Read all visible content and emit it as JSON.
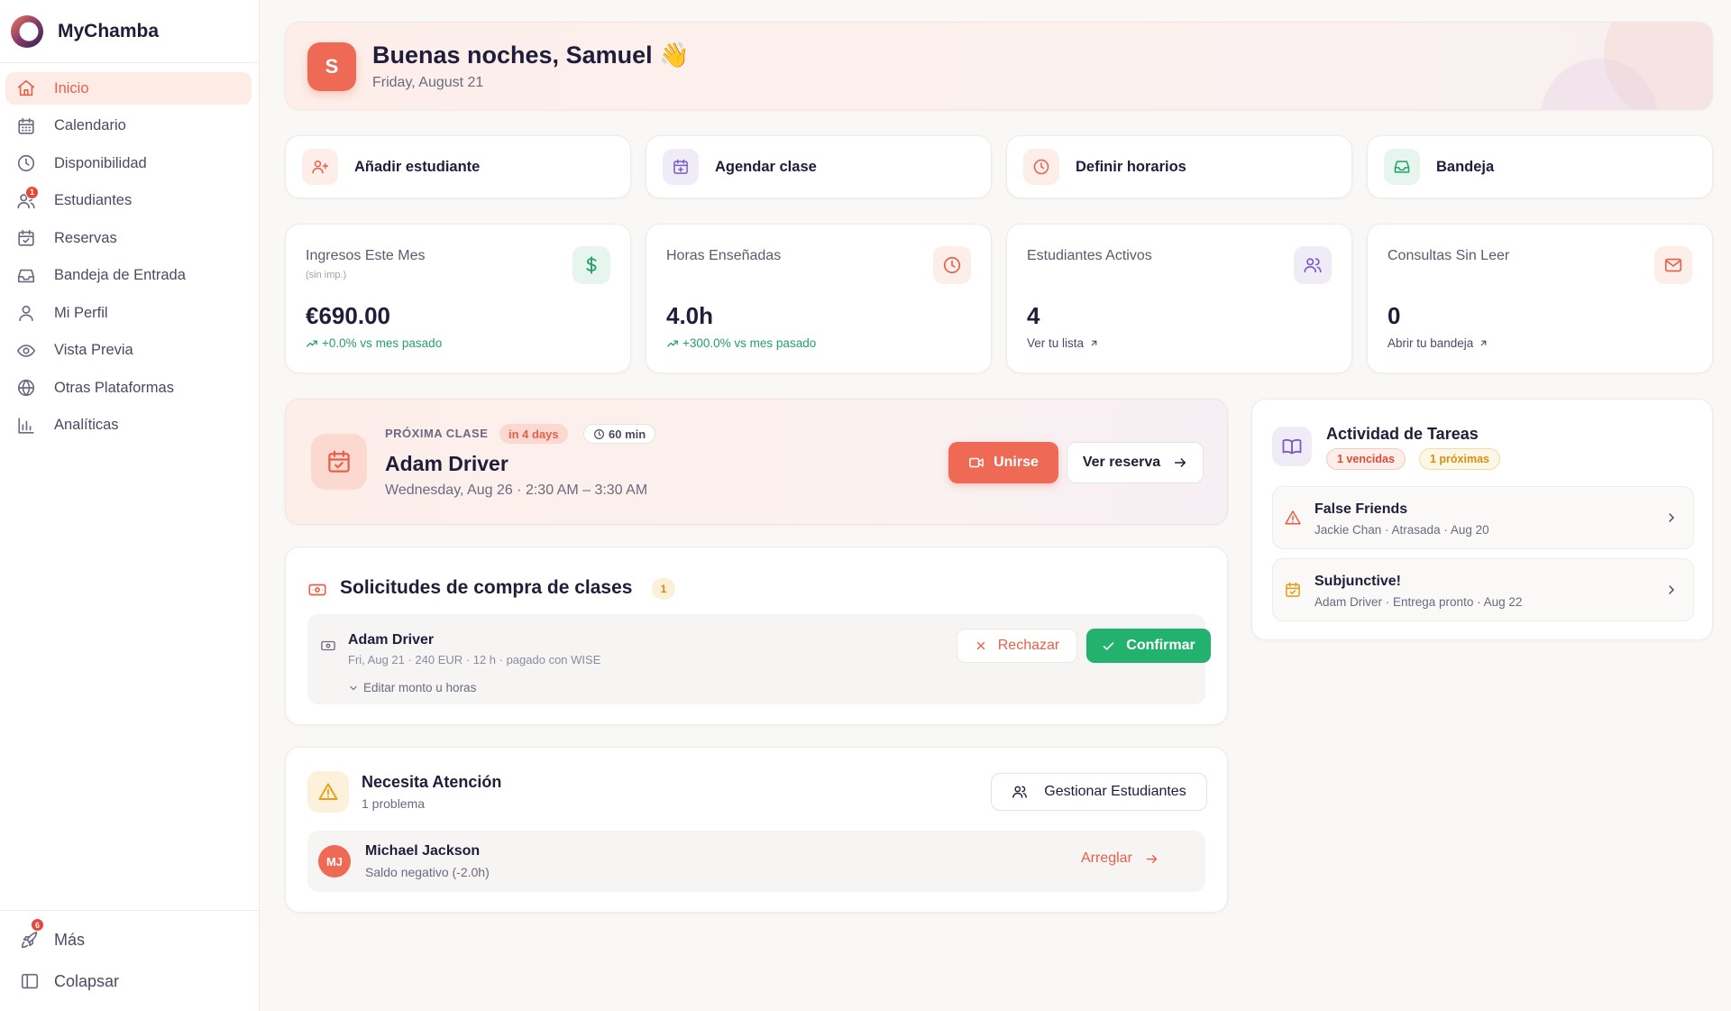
{
  "brand": {
    "name": "MyChamba"
  },
  "sidebar": {
    "items": [
      {
        "label": "Inicio",
        "icon": "home-icon",
        "active": true
      },
      {
        "label": "Calendario",
        "icon": "calendar-icon"
      },
      {
        "label": "Disponibilidad",
        "icon": "clock-icon"
      },
      {
        "label": "Estudiantes",
        "icon": "users-icon",
        "badge": "1"
      },
      {
        "label": "Reservas",
        "icon": "calendar-check-icon"
      },
      {
        "label": "Bandeja de Entrada",
        "icon": "inbox-icon"
      },
      {
        "label": "Mi Perfil",
        "icon": "user-icon"
      },
      {
        "label": "Vista Previa",
        "icon": "eye-icon"
      },
      {
        "label": "Otras Plataformas",
        "icon": "globe-icon"
      },
      {
        "label": "Analíticas",
        "icon": "bar-chart-icon"
      }
    ],
    "footer": {
      "more_label": "Más",
      "more_badge": "6",
      "collapse_label": "Colapsar"
    }
  },
  "greeting": {
    "avatar_initial": "S",
    "title": "Buenas noches, Samuel 👋",
    "date": "Friday, August 21"
  },
  "quick_actions": [
    {
      "label": "Añadir estudiante",
      "icon": "user-plus-icon",
      "color": "#e8604c",
      "bg": "#fdeeea"
    },
    {
      "label": "Agendar clase",
      "icon": "calendar-plus-icon",
      "color": "#7c5cc4",
      "bg": "#f0ecf7"
    },
    {
      "label": "Definir horarios",
      "icon": "clock-icon",
      "color": "#e8604c",
      "bg": "#fdeeea"
    },
    {
      "label": "Bandeja",
      "icon": "inbox-icon",
      "color": "#22a06b",
      "bg": "#e6f6ee"
    }
  ],
  "stats": [
    {
      "title": "Ingresos Este Mes",
      "sub": "(sin imp.)",
      "value": "€690.00",
      "delta": "+0.0% vs mes pasado",
      "delta_color": "#22a06b",
      "icon": "dollar-icon",
      "icon_color": "#22a06b",
      "icon_bg": "#e6f6ee"
    },
    {
      "title": "Horas Enseñadas",
      "sub": "",
      "value": "4.0h",
      "delta": "+300.0% vs mes pasado",
      "delta_color": "#22a06b",
      "icon": "clock-icon",
      "icon_color": "#e8604c",
      "icon_bg": "#fdeeea"
    },
    {
      "title": "Estudiantes Activos",
      "sub": "",
      "value": "4",
      "link": "Ver tu lista",
      "icon": "users-icon",
      "icon_color": "#7c5cc4",
      "icon_bg": "#f0ecf7"
    },
    {
      "title": "Consultas Sin Leer",
      "sub": "",
      "value": "0",
      "link": "Abrir tu bandeja",
      "icon": "mail-icon",
      "icon_color": "#e8604c",
      "icon_bg": "#fdeeea"
    }
  ],
  "next_class": {
    "tag": "PRÓXIMA CLASE",
    "in_days": "in 4 days",
    "duration": "60 min",
    "student": "Adam Driver",
    "when": "Wednesday, Aug 26 · 2:30 AM – 3:30 AM",
    "join_label": "Unirse",
    "view_label": "Ver reserva"
  },
  "requests": {
    "title": "Solicitudes de compra de clases",
    "count": "1",
    "items": [
      {
        "name": "Adam Driver",
        "meta": "Fri, Aug 21 · 240 EUR · 12 h · pagado con WISE",
        "edit_label": "Editar monto u horas",
        "reject_label": "Rechazar",
        "confirm_label": "Confirmar"
      }
    ]
  },
  "attention": {
    "title": "Necesita Atención",
    "subtitle": "1 problema",
    "manage_label": "Gestionar Estudiantes",
    "items": [
      {
        "initials": "MJ",
        "name": "Michael Jackson",
        "detail": "Saldo negativo (-2.0h)",
        "fix_label": "Arreglar"
      }
    ]
  },
  "tasks": {
    "title": "Actividad de Tareas",
    "overdue": "1 vencidas",
    "upcoming": "1 próximas",
    "items": [
      {
        "title": "False Friends",
        "meta": "Jackie Chan · Atrasada · Aug 20",
        "icon": "alert-triangle-icon",
        "color": "#e8604c"
      },
      {
        "title": "Subjunctive!",
        "meta": "Adam Driver · Entrega pronto · Aug 22",
        "icon": "calendar-check-icon",
        "color": "#e2a11b"
      }
    ]
  }
}
